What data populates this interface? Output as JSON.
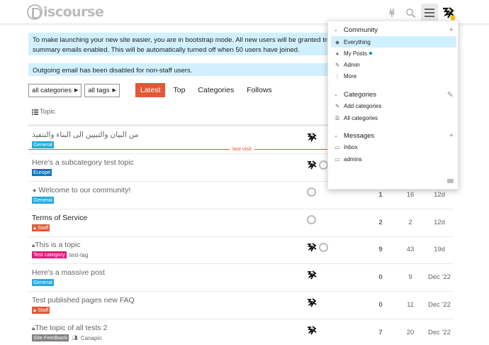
{
  "header": {
    "logo_text": "iscourse",
    "icons": [
      "plug-icon",
      "search-icon",
      "hamburger-icon",
      "avatar"
    ]
  },
  "notices": {
    "bootstrap": "To make launching your new site easier, you are in bootstrap mode. All new users will be granted trust level 1 and have daily email summary emails enabled. This will be automatically turned off when 50 users have joined.",
    "email": "Outgoing email has been disabled for non-staff users."
  },
  "nav": {
    "categories_dropdown": "all categories",
    "tags_dropdown": "all tags",
    "items": [
      "Latest",
      "Top",
      "Categories",
      "Follows"
    ],
    "active": "Latest"
  },
  "table": {
    "topic_header": "Topic",
    "last_visit": "last visit",
    "rows": [
      {
        "title": "من البيان والتبيين الى البناء والتنفيذ",
        "category": "General",
        "cat_color": "#25aae1",
        "tags": "",
        "replies": "",
        "views": "",
        "activity": "",
        "pinned": false,
        "locked": false
      },
      {
        "title": "Here's a subcategory test topic",
        "category": "Europe",
        "cat_color": "#0e76bd",
        "tags": "",
        "replies": "",
        "views": "",
        "activity": "",
        "pinned": false,
        "locked": false
      },
      {
        "title": "Welcome to our community!",
        "category": "General",
        "cat_color": "#25aae1",
        "tags": "",
        "replies": "1",
        "views": "16",
        "activity": "12d",
        "pinned": true,
        "locked": false
      },
      {
        "title": "Terms of Service",
        "category": "Staff",
        "cat_color": "#e45735",
        "tags": "",
        "replies": "2",
        "views": "2",
        "activity": "12d",
        "pinned": false,
        "locked": false,
        "unread": true
      },
      {
        "title": "This is a topic",
        "category": "Test category",
        "cat_color": "#e01b7b",
        "tags": "test-tag",
        "replies": "9",
        "views": "43",
        "activity": "19d",
        "pinned": false,
        "locked": true
      },
      {
        "title": "Here's a massive post",
        "category": "General",
        "cat_color": "#25aae1",
        "tags": "",
        "replies": "0",
        "views": "9",
        "activity": "Dec '22",
        "pinned": false,
        "locked": false
      },
      {
        "title": "Test published pages new FAQ",
        "category": "Staff",
        "cat_color": "#e45735",
        "tags": "",
        "replies": "0",
        "views": "11",
        "activity": "Dec '22",
        "pinned": false,
        "locked": false
      },
      {
        "title": "The topic of all tests 2",
        "category": "Site Feedback",
        "cat_color": "#808281",
        "tags": "Canapin",
        "replies": "7",
        "views": "20",
        "activity": "Dec '22",
        "pinned": false,
        "locked": true
      }
    ]
  },
  "menu": {
    "community": {
      "title": "Community",
      "items": [
        "Everything",
        "My Posts",
        "Admin",
        "More"
      ]
    },
    "categories": {
      "title": "Categories",
      "items": [
        "Add categories",
        "All categories"
      ]
    },
    "messages": {
      "title": "Messages",
      "items": [
        "Inbox",
        "admins"
      ]
    }
  },
  "colors": {
    "accent": "#e45735",
    "notice_bg": "#d1f0ff",
    "selected_bg": "#d1f0ff"
  }
}
